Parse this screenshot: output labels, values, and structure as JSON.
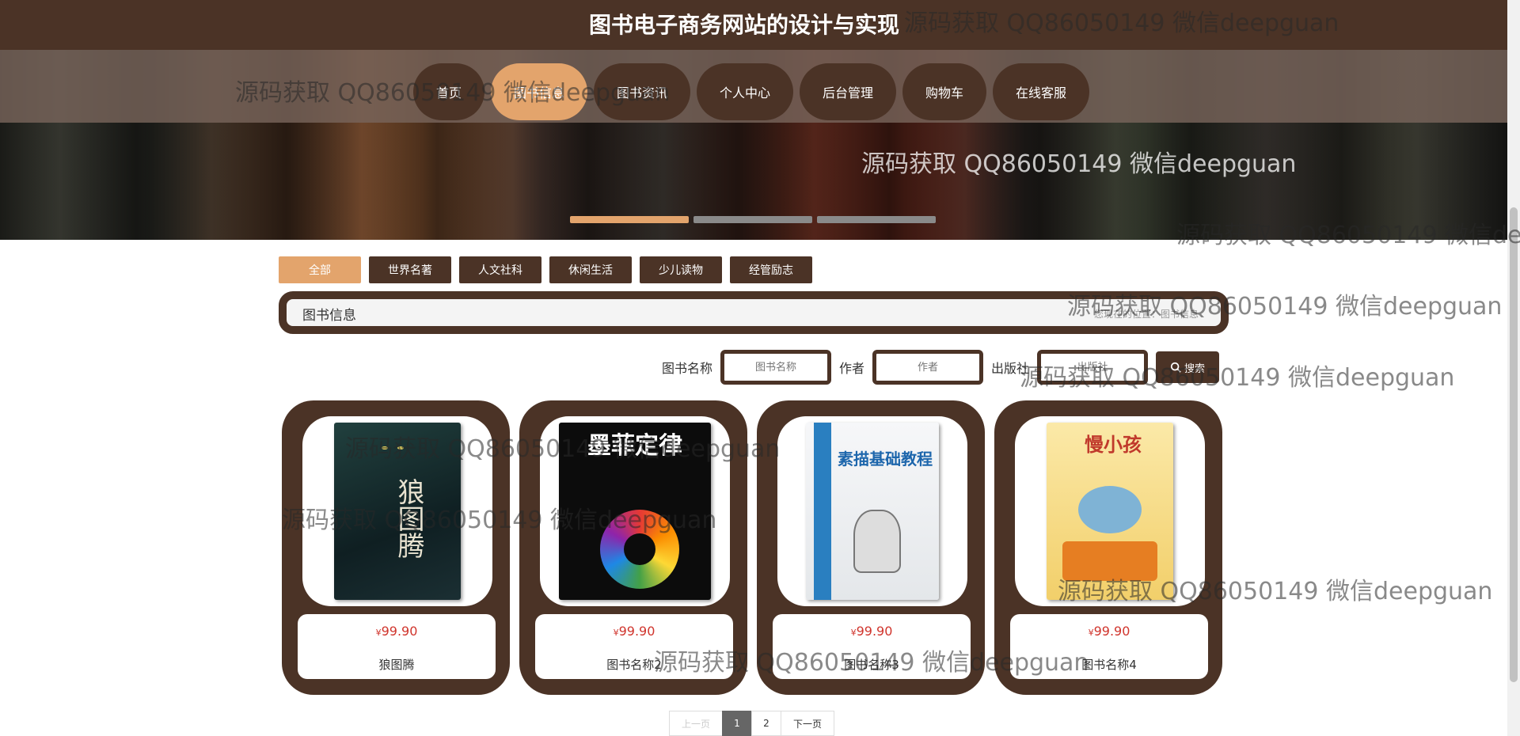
{
  "site": {
    "title": "图书电子商务网站的设计与实现"
  },
  "nav": {
    "items": [
      {
        "label": "首页",
        "active": false
      },
      {
        "label": "图书信息",
        "active": true
      },
      {
        "label": "图书资讯",
        "active": false
      },
      {
        "label": "个人中心",
        "active": false
      },
      {
        "label": "后台管理",
        "active": false
      },
      {
        "label": "购物车",
        "active": false
      },
      {
        "label": "在线客服",
        "active": false
      }
    ]
  },
  "carousel": {
    "slides": 3,
    "active": 0
  },
  "categories": [
    {
      "label": "全部",
      "active": true
    },
    {
      "label": "世界名著",
      "active": false
    },
    {
      "label": "人文社科",
      "active": false
    },
    {
      "label": "休闲生活",
      "active": false
    },
    {
      "label": "少儿读物",
      "active": false
    },
    {
      "label": "经管励志",
      "active": false
    }
  ],
  "infobar": {
    "title": "图书信息",
    "breadcrumb": "您现在的位置：图书信息"
  },
  "search": {
    "name_label": "图书名称",
    "name_placeholder": "图书名称",
    "author_label": "作者",
    "author_placeholder": "作者",
    "publisher_label": "出版社",
    "publisher_placeholder": "出版社",
    "button_label": "搜索"
  },
  "products": [
    {
      "currency": "¥",
      "price": "99.90",
      "name": "狼图腾",
      "cover_title": "狼图腾"
    },
    {
      "currency": "¥",
      "price": "99.90",
      "name": "图书名称2",
      "cover_title": "墨菲定律"
    },
    {
      "currency": "¥",
      "price": "99.90",
      "name": "图书名称3",
      "cover_title": "素描基础教程"
    },
    {
      "currency": "¥",
      "price": "99.90",
      "name": "图书名称4",
      "cover_title": "慢小孩"
    }
  ],
  "pagination": {
    "prev": "上一页",
    "pages": [
      "1",
      "2"
    ],
    "current": "1",
    "next": "下一页"
  },
  "watermark": "源码获取 QQ86050149 微信deepguan"
}
